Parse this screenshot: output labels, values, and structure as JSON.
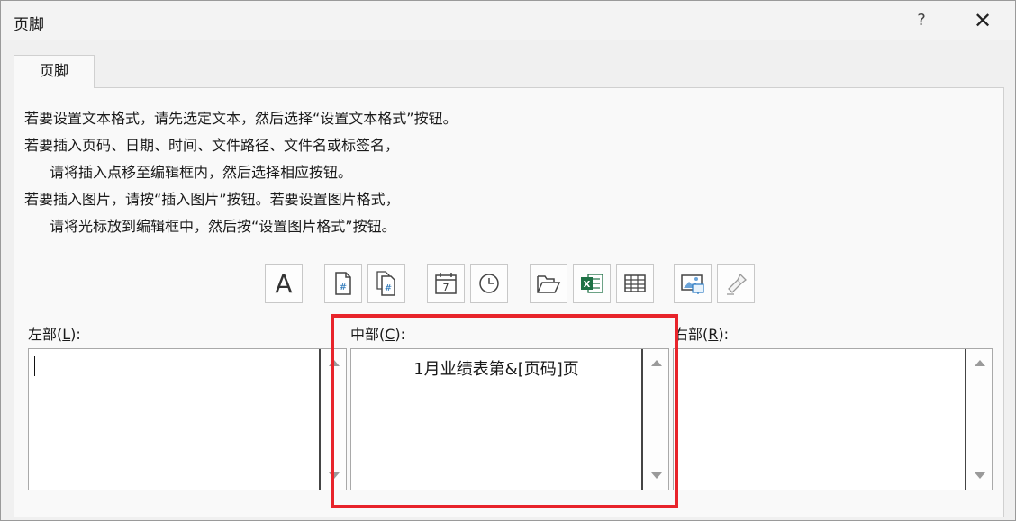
{
  "window": {
    "title": "页脚",
    "help_label": "?",
    "close_label": "✕"
  },
  "tabs": [
    {
      "label": "页脚"
    }
  ],
  "instructions": [
    "若要设置文本格式，请先选定文本，然后选择“设置文本格式”按钮。",
    "若要插入页码、日期、时间、文件路径、文件名或标签名，",
    "请将插入点移至编辑框内，然后选择相应按钮。",
    "若要插入图片，请按“插入图片”按钮。若要设置图片格式，",
    "请将光标放到编辑框中，然后按“设置图片格式”按钮。"
  ],
  "toolbar": {
    "format_text_glyph": "A",
    "buttons": [
      "format-text",
      "insert-page-number",
      "insert-page-count",
      "insert-date",
      "insert-time",
      "insert-file-path",
      "insert-file-name",
      "insert-sheet-name",
      "insert-picture",
      "format-picture"
    ]
  },
  "sections": {
    "left": {
      "label_pre": "左部(",
      "hotkey": "L",
      "label_post": "):",
      "value": ""
    },
    "center": {
      "label_pre": "中部(",
      "hotkey": "C",
      "label_post": "):",
      "value": "1月业绩表第&[页码]页"
    },
    "right": {
      "label_pre": "右部(",
      "hotkey": "R",
      "label_post": "):",
      "value": ""
    }
  },
  "colors": {
    "highlight": "#e8242b",
    "excel_green": "#1e7145"
  }
}
